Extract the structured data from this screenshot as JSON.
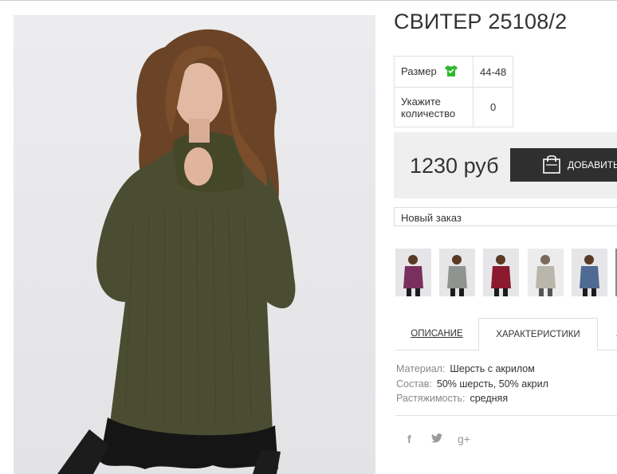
{
  "product": {
    "title": "СВИТЕР 25108/2",
    "image_alt": "product-photo"
  },
  "params": {
    "size_label": "Размер",
    "size_value": "44-48",
    "qty_label_line1": "Укажите",
    "qty_label_line2": "количество",
    "qty_value": "0"
  },
  "buy": {
    "price": "1230 руб",
    "add_label": "ДОБАВИТЬ"
  },
  "order_select": {
    "value": "Новый заказ"
  },
  "color_thumbs": [
    {
      "name": "purple",
      "color": "#7b2f5e"
    },
    {
      "name": "grey",
      "color": "#8f9491"
    },
    {
      "name": "burgundy",
      "color": "#8b1a2f"
    },
    {
      "name": "light-grey",
      "color": "#b9b6ac"
    },
    {
      "name": "blue",
      "color": "#4f6a93"
    },
    {
      "name": "partial",
      "color": "#8a8a8a"
    }
  ],
  "tabs": {
    "description": "ОПИСАНИЕ",
    "characteristics": "ХАРАКТЕРИСТИКИ",
    "third_partial": "…"
  },
  "specs": [
    {
      "key": "Материал:",
      "value": "Шерсть с акрилом"
    },
    {
      "key": "Состав:",
      "value": "50% шерсть, 50% акрил"
    },
    {
      "key": "Растяжимость:",
      "value": "средняя"
    }
  ],
  "social": {
    "facebook": "f",
    "twitter": "twitter-icon",
    "googleplus": "g+"
  },
  "colors": {
    "sweater": "#4b4d32",
    "button_bg": "#2f2f2f",
    "size_icon": "#2eb82e"
  }
}
